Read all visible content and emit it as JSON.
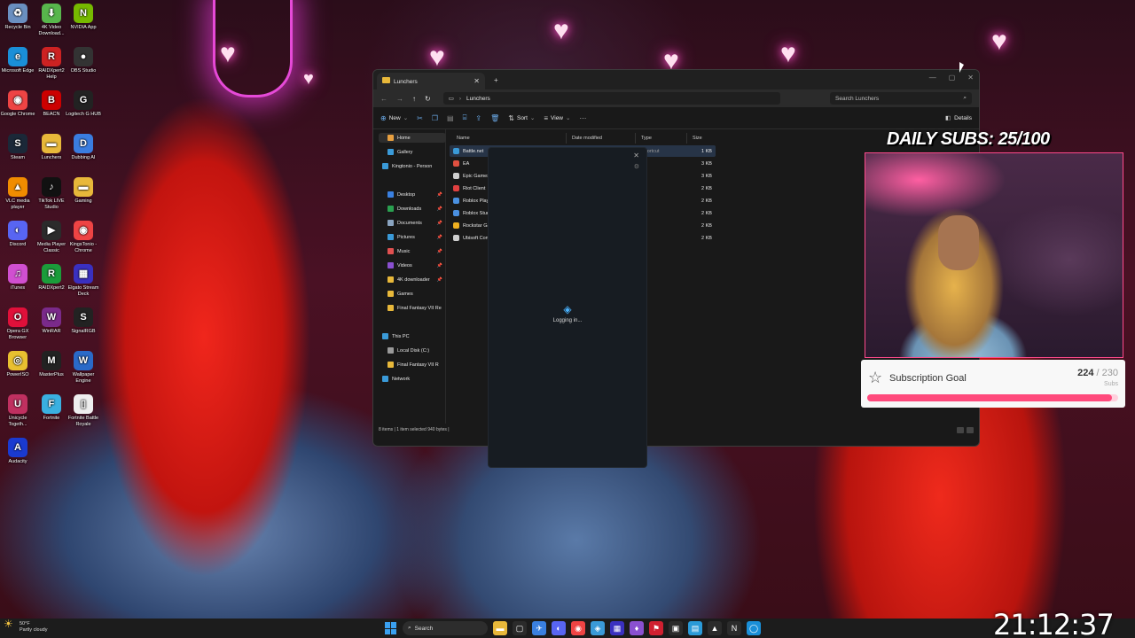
{
  "desktop": {
    "icons": [
      {
        "label": "Recycle Bin",
        "color": "#6a8fc0",
        "glyph": "♻"
      },
      {
        "label": "4K Video Download...",
        "color": "#58b64c",
        "glyph": "⬇"
      },
      {
        "label": "NVIDIA App",
        "color": "#76b900",
        "glyph": "N"
      },
      {
        "label": "Microsoft Edge",
        "color": "#1a8fd8",
        "glyph": "e"
      },
      {
        "label": "RAIDXpert2 Help",
        "color": "#c22",
        "glyph": "R"
      },
      {
        "label": "OBS Studio",
        "color": "#333",
        "glyph": "●"
      },
      {
        "label": "Google Chrome",
        "color": "#e44",
        "glyph": "◉"
      },
      {
        "label": "BEACN",
        "color": "#c00",
        "glyph": "B"
      },
      {
        "label": "Logitech G HUB",
        "color": "#222",
        "glyph": "G"
      },
      {
        "label": "Steam",
        "color": "#1b2838",
        "glyph": "S"
      },
      {
        "label": "Lunchers",
        "color": "#e8b83a",
        "glyph": "▬"
      },
      {
        "label": "Dubbing AI",
        "color": "#3a7de0",
        "glyph": "D"
      },
      {
        "label": "VLC media player",
        "color": "#f08c00",
        "glyph": "▲"
      },
      {
        "label": "TikTok LIVE Studio",
        "color": "#111",
        "glyph": "♪"
      },
      {
        "label": "Gaming",
        "color": "#e8b83a",
        "glyph": "▬"
      },
      {
        "label": "Discord",
        "color": "#5865f2",
        "glyph": "◐"
      },
      {
        "label": "Media Player Classic",
        "color": "#2b2b2b",
        "glyph": "▶"
      },
      {
        "label": "KingsTonio - Chrome",
        "color": "#e44",
        "glyph": "◉"
      },
      {
        "label": "iTunes",
        "color": "#d04fd0",
        "glyph": "♫"
      },
      {
        "label": "RAIDXpert2",
        "color": "#1b9c3a",
        "glyph": "R"
      },
      {
        "label": "Elgato Stream Deck",
        "color": "#3a30c0",
        "glyph": "▦"
      },
      {
        "label": "Opera GX Browser",
        "color": "#e0103a",
        "glyph": "O"
      },
      {
        "label": "WinRAR",
        "color": "#7a2a8a",
        "glyph": "W"
      },
      {
        "label": "SignalRGB",
        "color": "#222",
        "glyph": "S"
      },
      {
        "label": "PowerISO",
        "color": "#e8c030",
        "glyph": "◎"
      },
      {
        "label": "MasterPlus",
        "color": "#222",
        "glyph": "M"
      },
      {
        "label": "Wallpaper Engine",
        "color": "#2a6ac8",
        "glyph": "W"
      },
      {
        "label": "Unicycle Togeth...",
        "color": "#c03060",
        "glyph": "U"
      },
      {
        "label": "Fortnite",
        "color": "#3ab0e0",
        "glyph": "F"
      },
      {
        "label": "Fortnite Battle Royale",
        "color": "#eee",
        "glyph": "▯"
      },
      {
        "label": "Audacity",
        "color": "#1a3ad0",
        "glyph": "A"
      }
    ]
  },
  "explorer": {
    "tab_title": "Lunchers",
    "address": "Lunchers",
    "search_placeholder": "Search Lunchers",
    "cmd_new": "New",
    "cmd_sort": "Sort",
    "cmd_view": "View",
    "cmd_details": "Details",
    "columns": {
      "name": "Name",
      "date": "Date modified",
      "type": "Type",
      "size": "Size"
    },
    "nav": [
      {
        "label": "Home",
        "color": "#e8a040"
      },
      {
        "label": "Gallery",
        "color": "#3a9ad8"
      },
      {
        "label": "Kingtonio - Person",
        "color": "#3a9ad8"
      },
      {
        "label": "Desktop",
        "color": "#3a80e0"
      },
      {
        "label": "Downloads",
        "color": "#2aa050"
      },
      {
        "label": "Documents",
        "color": "#8aa4c0"
      },
      {
        "label": "Pictures",
        "color": "#3a9ad8"
      },
      {
        "label": "Music",
        "color": "#e05050"
      },
      {
        "label": "Videos",
        "color": "#8a50d0"
      },
      {
        "label": "4K downloader",
        "color": "#e8b83a"
      },
      {
        "label": "Games",
        "color": "#e8b83a"
      },
      {
        "label": "Final Fantasy VII Re",
        "color": "#e8b83a"
      },
      {
        "label": "This PC",
        "color": "#3a9ad8"
      },
      {
        "label": "Local Disk (C:)",
        "color": "#9a9a9a"
      },
      {
        "label": "Final Fantasy VII R",
        "color": "#e8b83a"
      },
      {
        "label": "Network",
        "color": "#3a9ad8"
      }
    ],
    "files": [
      {
        "name": "Battle.net",
        "date": "1/23/2026 4:55 AM",
        "type": "Shortcut",
        "size": "1 KB",
        "color": "#3a9ad8"
      },
      {
        "name": "EA",
        "date": "",
        "type": "t",
        "size": "3 KB",
        "color": "#e05040"
      },
      {
        "name": "Epic Games",
        "date": "",
        "type": "t",
        "size": "3 KB",
        "color": "#cfcfcf"
      },
      {
        "name": "Riot Client",
        "date": "",
        "type": "t",
        "size": "2 KB",
        "color": "#e04040"
      },
      {
        "name": "Roblox Play",
        "date": "",
        "type": "t",
        "size": "2 KB",
        "color": "#4a90e0"
      },
      {
        "name": "Roblox Stud",
        "date": "",
        "type": "t",
        "size": "2 KB",
        "color": "#4a90e0"
      },
      {
        "name": "Rockstar Ga",
        "date": "",
        "type": "t",
        "size": "2 KB",
        "color": "#f0b020"
      },
      {
        "name": "Ubisoft Con",
        "date": "",
        "type": "t",
        "size": "2 KB",
        "color": "#cfcfcf"
      }
    ],
    "status": "8 items  |  1 item selected  940 bytes  |"
  },
  "launcher": {
    "status_text": "Logging in..."
  },
  "overlay": {
    "daily_subs": "DAILY SUBS: 25/100",
    "goal_title": "Subscription Goal",
    "goal_current": "224",
    "goal_target": "/ 230",
    "goal_unit": "Subs",
    "goal_progress": 0.974
  },
  "taskbar": {
    "weather_temp": "50°F",
    "weather_desc": "Partly cloudy",
    "search_label": "Search",
    "apps": [
      {
        "color": "#e8b83a",
        "glyph": "▬"
      },
      {
        "color": "#2b2b2b",
        "glyph": "▢"
      },
      {
        "color": "#3a80e0",
        "glyph": "✈"
      },
      {
        "color": "#5865f2",
        "glyph": "◐"
      },
      {
        "color": "#e44",
        "glyph": "◉"
      },
      {
        "color": "#3a9ad8",
        "glyph": "◈"
      },
      {
        "color": "#3a30c0",
        "glyph": "▦"
      },
      {
        "color": "#8a50d0",
        "glyph": "♦"
      },
      {
        "color": "#d02030",
        "glyph": "⚑"
      },
      {
        "color": "#2b2b2b",
        "glyph": "▣"
      },
      {
        "color": "#2a9ad8",
        "glyph": "▤"
      },
      {
        "color": "#2b2b2b",
        "glyph": "▲"
      },
      {
        "color": "#2b2b2b",
        "glyph": "N"
      },
      {
        "color": "#1a8fd8",
        "glyph": "◯"
      }
    ]
  },
  "clock": "21:12:37"
}
